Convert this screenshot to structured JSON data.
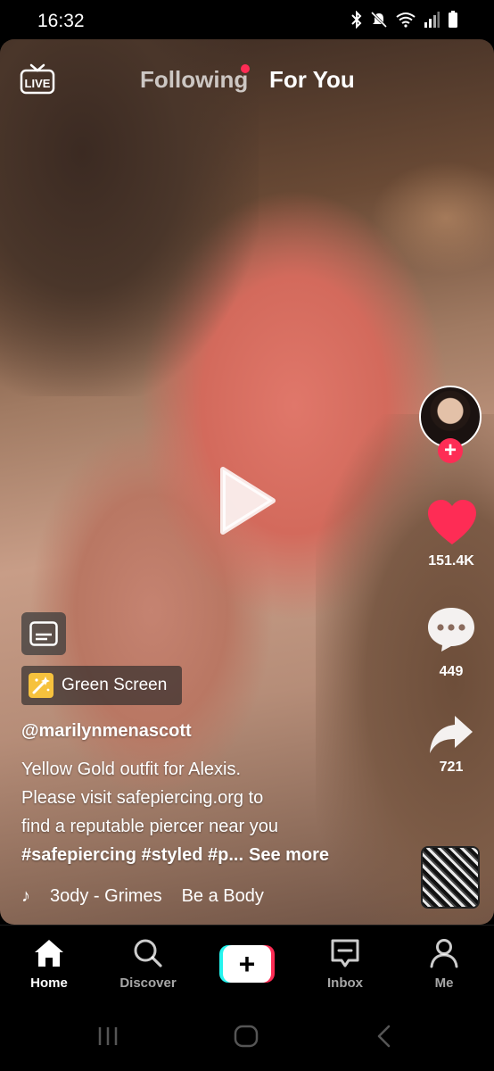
{
  "status_bar": {
    "time": "16:32",
    "icons": [
      "bluetooth-icon",
      "mute-icon",
      "wifi-icon",
      "signal-icon",
      "battery-icon"
    ]
  },
  "top_nav": {
    "live_label": "LIVE",
    "tabs": [
      {
        "label": "Following",
        "active": false,
        "has_dot": true
      },
      {
        "label": "For You",
        "active": true
      }
    ]
  },
  "video": {
    "paused": true
  },
  "actions": {
    "likes": "151.4K",
    "comments": "449",
    "shares": "721"
  },
  "effect": {
    "label": "Green Screen"
  },
  "post": {
    "username": "@marilynmenascott",
    "description_lines": [
      "Yellow Gold outfit for Alexis.",
      "Please visit safepiercing.org to",
      "find a reputable piercer near you"
    ],
    "hashtags": "#safepiercing #styled #p...",
    "see_more": "See more"
  },
  "music": {
    "track": "3ody - Grimes",
    "track2": "Be a Body"
  },
  "bottom_nav": {
    "items": [
      {
        "label": "Home",
        "icon": "home-icon",
        "active": true
      },
      {
        "label": "Discover",
        "icon": "search-icon",
        "active": false
      },
      {
        "label": "",
        "icon": "create-icon",
        "active": false
      },
      {
        "label": "Inbox",
        "icon": "inbox-icon",
        "active": false
      },
      {
        "label": "Me",
        "icon": "profile-icon",
        "active": false
      }
    ],
    "create_symbol": "+"
  },
  "colors": {
    "accent_red": "#fe2c55",
    "accent_cyan": "#25f4ee",
    "effect_badge": "#f6c23d"
  }
}
